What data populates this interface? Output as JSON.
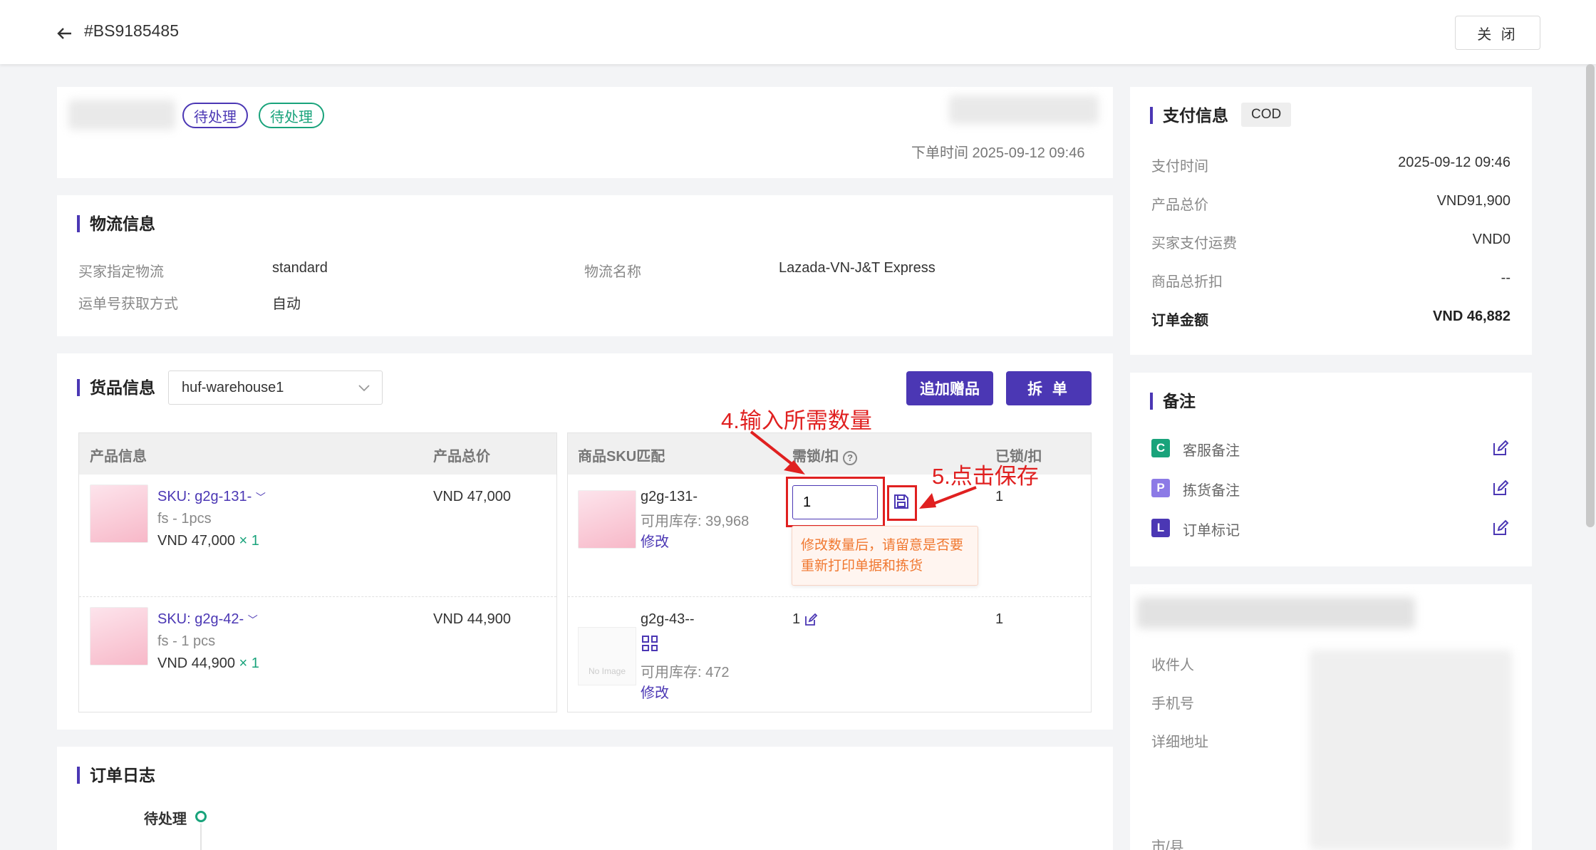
{
  "header": {
    "order_no": "#BS9185485",
    "close_label": "关 闭"
  },
  "order_card": {
    "tags": [
      "待处理",
      "待处理"
    ],
    "order_time_label": "下单时间 2025-09-12 09:46"
  },
  "logistics": {
    "title": "物流信息",
    "buyer_logistics_label": "买家指定物流",
    "buyer_logistics_value": "standard",
    "logistics_name_label": "物流名称",
    "logistics_name_value": "Lazada-VN-J&T Express",
    "tracking_method_label": "运单号获取方式",
    "tracking_method_value": "自动"
  },
  "goods": {
    "title": "货品信息",
    "warehouse": "huf-warehouse1",
    "add_gift_label": "追加赠品",
    "split_label": "拆 单",
    "col_product": "产品信息",
    "col_total": "产品总价",
    "col_sku_match": "商品SKU匹配",
    "col_need_lock": "需锁/扣",
    "col_locked": "已锁/扣",
    "rows": [
      {
        "sku": "SKU: g2g-131-",
        "spec": "fs - 1pcs",
        "price": "VND 47,000",
        "times": "×",
        "qty": "1",
        "total": "VND 47,000",
        "match_sku": "g2g-131-",
        "stock": "可用库存: 39,968",
        "modify": "修改",
        "need": "1",
        "locked": "1"
      },
      {
        "sku": "SKU: g2g-42-",
        "spec": "fs - 1 pcs",
        "price": "VND 44,900",
        "times": "×",
        "qty": "1",
        "total": "VND 44,900",
        "match_sku": "g2g-43--",
        "stock": "可用库存: 472",
        "modify": "修改",
        "need": "1",
        "locked": "1"
      }
    ],
    "tooltip": "修改数量后，请留意是否要重新打印单据和拣货",
    "no_image": "No Image"
  },
  "annotations": {
    "step4": "4.输入所需数量",
    "step5": "5.点击保存"
  },
  "log": {
    "title": "订单日志",
    "status": "待处理"
  },
  "payment": {
    "title": "支付信息",
    "method": "COD",
    "rows": [
      {
        "label": "支付时间",
        "value": "2025-09-12 09:46"
      },
      {
        "label": "产品总价",
        "value": "VND91,900"
      },
      {
        "label": "买家支付运费",
        "value": "VND0"
      },
      {
        "label": "商品总折扣",
        "value": "--"
      }
    ],
    "total_label": "订单金额",
    "total_value": "VND 46,882"
  },
  "notes": {
    "title": "备注",
    "items": [
      {
        "letter": "C",
        "label": "客服备注",
        "color": "#19a37b"
      },
      {
        "letter": "P",
        "label": "拣货备注",
        "color": "#8c7ae6"
      },
      {
        "letter": "L",
        "label": "订单标记",
        "color": "#4b37b4"
      }
    ]
  },
  "receiver": {
    "rows": [
      "收件人",
      "手机号",
      "详细地址",
      "市/县"
    ]
  },
  "colors": {
    "accent": "#4b37b4",
    "green": "#19a37b",
    "annotation": "#e02020"
  }
}
